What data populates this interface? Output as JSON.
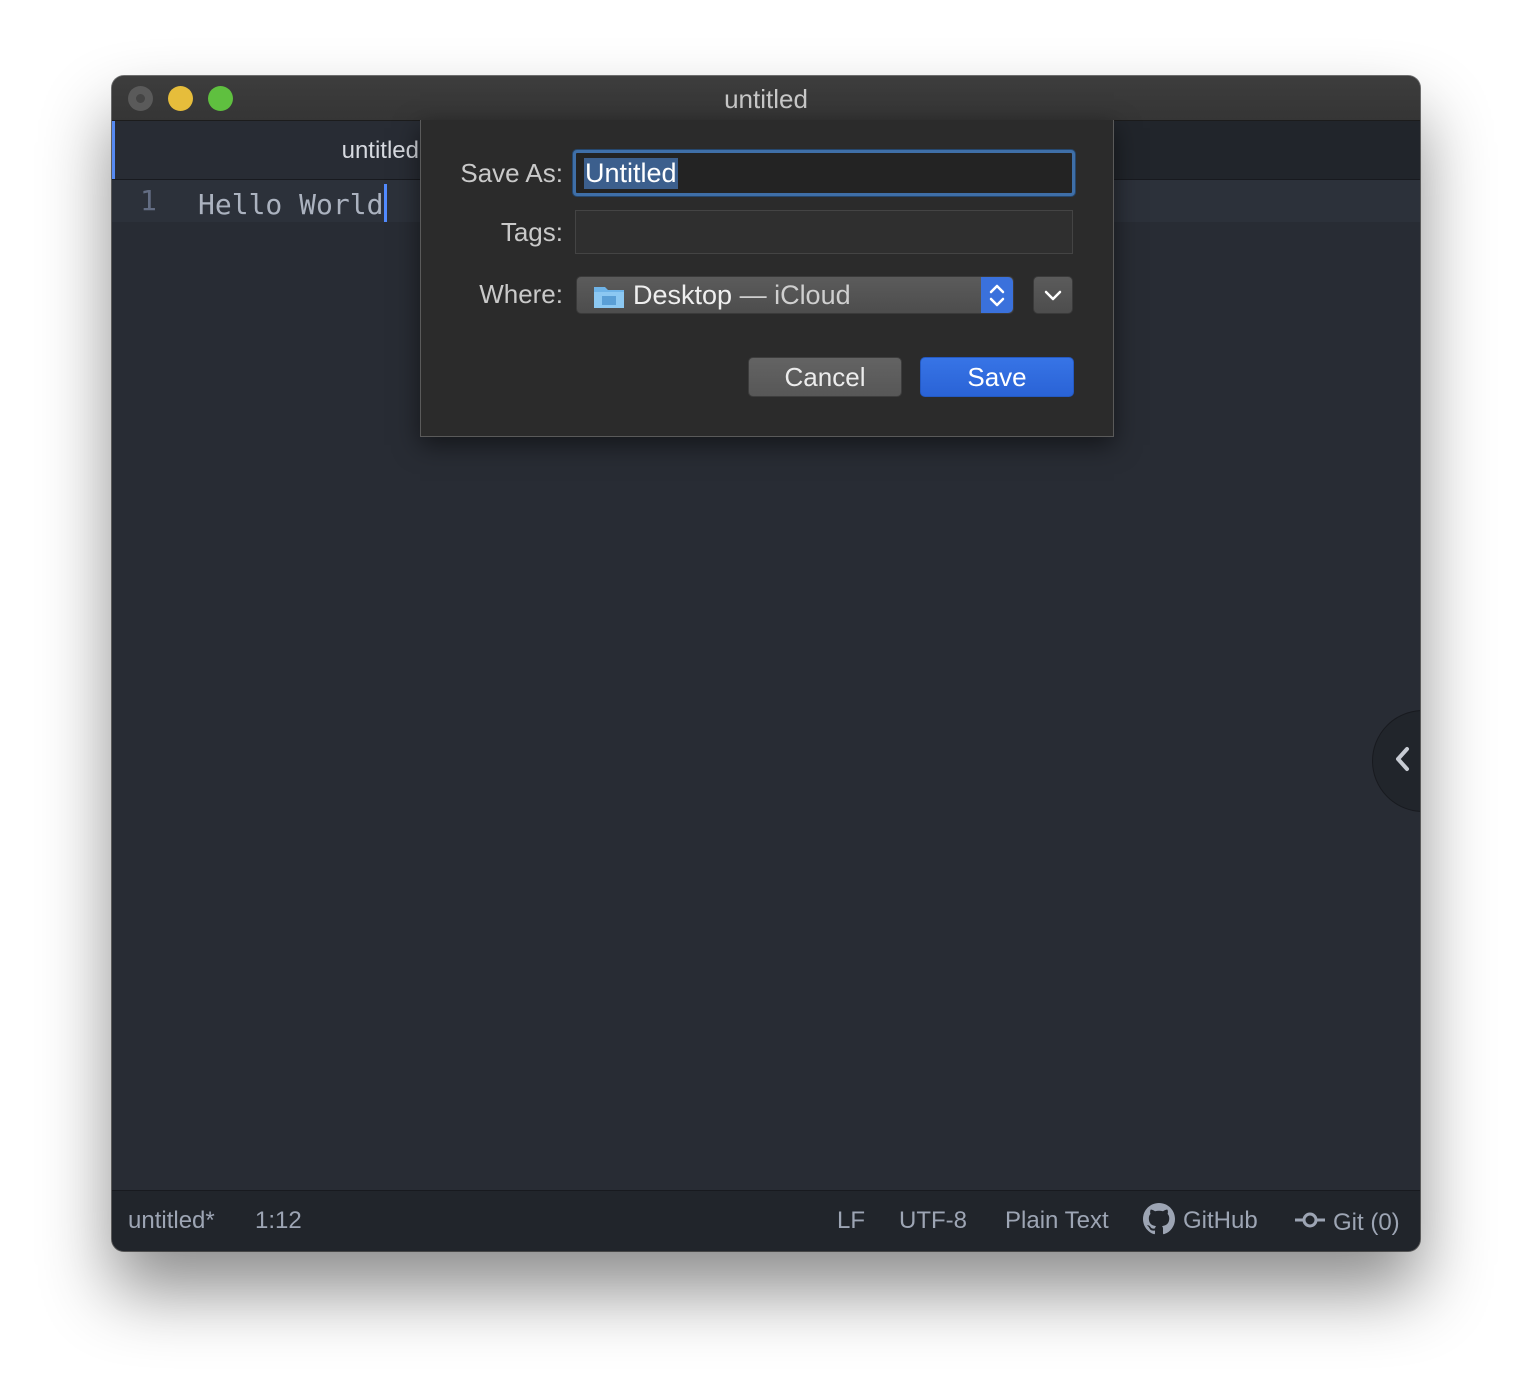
{
  "window": {
    "title": "untitled"
  },
  "tabs": [
    {
      "label": "untitled"
    }
  ],
  "editor": {
    "lines": [
      {
        "number": "1",
        "text": "Hello World"
      }
    ]
  },
  "save_dialog": {
    "save_as_label": "Save As:",
    "save_as_value": "Untitled",
    "tags_label": "Tags:",
    "tags_value": "",
    "where_label": "Where:",
    "where_folder": "Desktop",
    "where_service": " — iCloud",
    "cancel_label": "Cancel",
    "save_label": "Save"
  },
  "status_bar": {
    "file": "untitled*",
    "cursor_position": "1:12",
    "line_ending": "LF",
    "encoding": "UTF-8",
    "grammar": "Plain Text",
    "github_label": "GitHub",
    "git_label": "Git (0)"
  },
  "colors": {
    "accent": "#568af2",
    "save_button": "#2a63d6",
    "editor_bg": "#282c34"
  }
}
